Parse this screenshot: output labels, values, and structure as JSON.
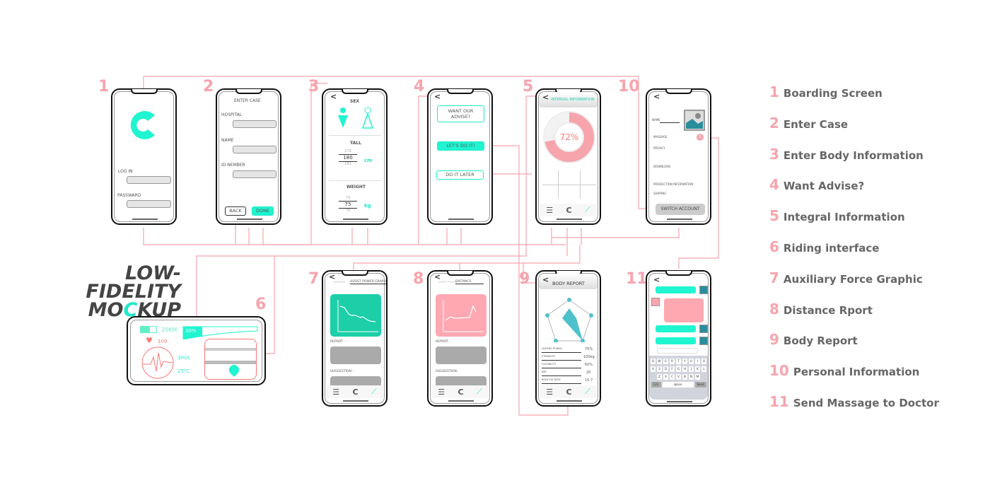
{
  "title": {
    "line1": "LOW-FIDELITY",
    "line2_pre": "MO",
    "line2_c": "C",
    "line2_post": "KUP"
  },
  "colors": {
    "pink": "#f7a4ad",
    "teal": "#1ff5d0",
    "chart_teal": "#1ccfa8"
  },
  "legend": [
    {
      "num": "1",
      "label": "Boarding Screen"
    },
    {
      "num": "2",
      "label": "Enter Case"
    },
    {
      "num": "3",
      "label": "Enter Body Information"
    },
    {
      "num": "4",
      "label": "Want Advise?"
    },
    {
      "num": "5",
      "label": "Integral Information"
    },
    {
      "num": "6",
      "label": "Riding interface"
    },
    {
      "num": "7",
      "label": "Auxiliary Force Graphic"
    },
    {
      "num": "8",
      "label": "Distance Rport"
    },
    {
      "num": "9",
      "label": "Body Report"
    },
    {
      "num": "10",
      "label": "Personal Information"
    },
    {
      "num": "11",
      "label": "Send Massage to Doctor"
    }
  ],
  "s1": {
    "login": "LOG IN",
    "password": "PASSWARD"
  },
  "s2": {
    "title": "ENTER CASE",
    "hospital": "HOSPITAL",
    "name": "NAME",
    "id": "ID NEMBER",
    "back": "BACK",
    "done": "DONE"
  },
  "s3": {
    "sex": "SEX",
    "tall": "TALL",
    "tall_vals": [
      "178",
      "179",
      "180",
      "181",
      "182"
    ],
    "cm": "cm",
    "weight": "WEIGHT",
    "weight_vals": [
      "73",
      "74",
      "75",
      "76",
      "77"
    ],
    "kg": "kg"
  },
  "s4": {
    "question": "WANT OUR ADVISE?",
    "yes": "LET'S DO IT!",
    "later": "DO IT LATER"
  },
  "s5": {
    "header": "INTERGAL INFORMATION",
    "percent": "72%",
    "progress": 72
  },
  "s10": {
    "name": "NAME",
    "items": [
      "MASSAGE",
      "PRIVACY",
      "DOWNLOAD",
      "PRODUCTION INFORMATION",
      "SHARING"
    ],
    "badge": "1",
    "switch": "SWITCH ACCOUNT"
  },
  "s6": {
    "distance": "35KM",
    "assist": "30%",
    "heart": "109",
    "wind": "3m/s",
    "temp": "25°C"
  },
  "s7": {
    "tab_inactive": "DISTANCE",
    "tab_active": "ASSIST POWER GRAPH",
    "y_ticks": [
      "80",
      "40",
      "0"
    ],
    "report": "REPORT :",
    "suggestion": "SUGGESTION :"
  },
  "s8": {
    "tab_inactive": "ASSIST POWER",
    "tab_active": "DISTANCE",
    "y_ticks": [
      "KM",
      "4",
      "2",
      "0"
    ],
    "report": "REPORT :",
    "suggestion": "SUGGESTION :"
  },
  "s9": {
    "header": "BODY REPORT",
    "rows": [
      {
        "label": "LEATING POWER",
        "value": "75%"
      },
      {
        "label": "STRENGTH",
        "value": "100kg"
      },
      {
        "label": "FLEXIBILITY",
        "value": "60%"
      },
      {
        "label": "BMI",
        "value": "20"
      },
      {
        "label": "BODY FAT RATE",
        "value": "15.7"
      }
    ]
  },
  "s11": {
    "keys_row1": [
      "Q",
      "W",
      "E",
      "R",
      "T",
      "Y",
      "U",
      "I",
      "O",
      "P"
    ],
    "keys_row2": [
      "A",
      "S",
      "D",
      "F",
      "G",
      "H",
      "J",
      "K",
      "L"
    ],
    "keys_row3": [
      "Z",
      "X",
      "C",
      "V",
      "B",
      "N",
      "M"
    ],
    "k123": "123",
    "space": "space",
    "send": "Send"
  }
}
